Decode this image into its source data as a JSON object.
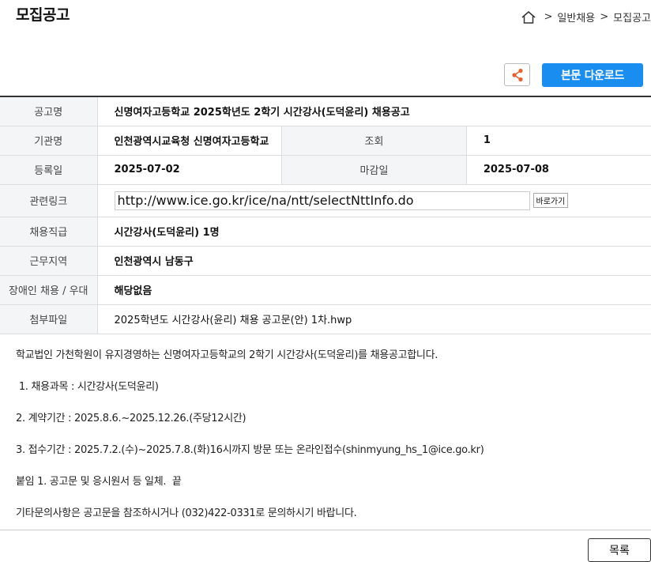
{
  "page": {
    "title": "모집공고"
  },
  "breadcrumb": {
    "separator": ">",
    "items": [
      "일반채용",
      "모집공고"
    ]
  },
  "actions": {
    "download_label": "본문 다운로드",
    "list_label": "목록"
  },
  "info": {
    "name_label": "공고명",
    "name_value": "신명여자고등학교 2025학년도 2학기 시간강사(도덕윤리) 채용공고",
    "org_label": "기관명",
    "org_value": "인천광역시교육청 신명여자고등학교",
    "views_label": "조회",
    "views_value": "1",
    "reg_label": "등록일",
    "reg_value": "2025-07-02",
    "deadline_label": "마감일",
    "deadline_value": "2025-07-08",
    "link_label": "관련링크",
    "link_value": "http://www.ice.go.kr/ice/na/ntt/selectNttInfo.do",
    "link_button": "바로가기",
    "job_label": "채용직급",
    "job_value": "시간강사(도덕윤리) 1명",
    "area_label": "근무지역",
    "area_value": "인천광역시 남동구",
    "disabled_label": "장애인 채용 / 우대",
    "disabled_value": "해당없음",
    "file_label": "첨부파일",
    "file_value": "2025학년도 시간강사(윤리) 채용 공고문(안) 1차.hwp"
  },
  "body": {
    "p1": "학교법인 가천학원이 유지경영하는 신명여자고등학교의 2학기 시간강사(도덕윤리)를 채용공고합니다.",
    "p2": " 1. 채용과목 : 시간강사(도덕윤리)",
    "p3": "2. 계약기간 : 2025.8.6.~2025.12.26.(주당12시간)",
    "p4": "3. 접수기간 : 2025.7.2.(수)~2025.7.8.(화)16시까지 방문 또는 온라인접수(shinmyung_hs_1@ice.go.kr)",
    "p5": "붙임 1. 공고문 및 응시원서 등 일체.  끝",
    "p6": "기타문의사항은 공고문을 참조하시거나 (032)422-0331로 문의하시기 바랍니다."
  },
  "icons": {
    "home": "home-icon",
    "share": "share-icon"
  },
  "colors": {
    "accent": "#1a8df0",
    "share": "#e8612c"
  }
}
